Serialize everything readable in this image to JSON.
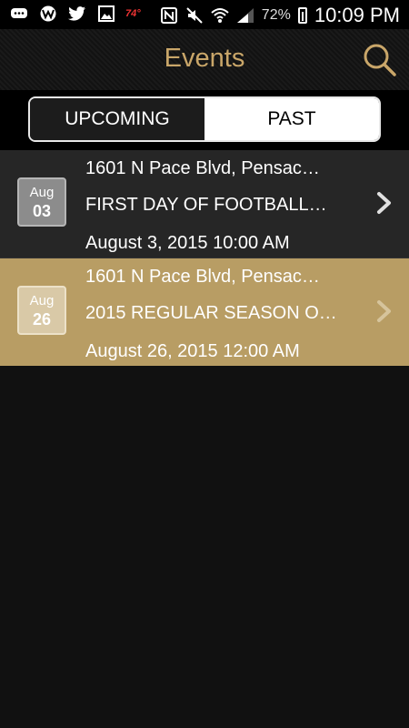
{
  "status_bar": {
    "temperature": "74°",
    "battery_percent": "72%",
    "time": "10:09 PM",
    "left_icons": [
      "chat-icon",
      "w-app-icon",
      "twitter-icon",
      "image-icon"
    ],
    "right_icons": [
      "nfc-icon",
      "mute-icon",
      "wifi-icon",
      "signal-icon",
      "battery-icon"
    ]
  },
  "header": {
    "title": "Events"
  },
  "tabs": [
    {
      "label": "UPCOMING",
      "selected": false
    },
    {
      "label": "PAST",
      "selected": true
    }
  ],
  "events": [
    {
      "month": "Aug",
      "day": "03",
      "address": "1601 N Pace Blvd, Pensac…",
      "name": "FIRST DAY OF FOOTBALL…",
      "datetime": "August 3, 2015 10:00 AM",
      "highlighted": false
    },
    {
      "month": "Aug",
      "day": "26",
      "address": "1601 N Pace Blvd, Pensac…",
      "name": "2015 REGULAR SEASON O…",
      "datetime": "August 26, 2015 12:00 AM",
      "highlighted": true
    }
  ],
  "colors": {
    "accent": "#c9a669",
    "highlight_row": "#b89d64",
    "row": "#262626",
    "background": "#111111"
  }
}
